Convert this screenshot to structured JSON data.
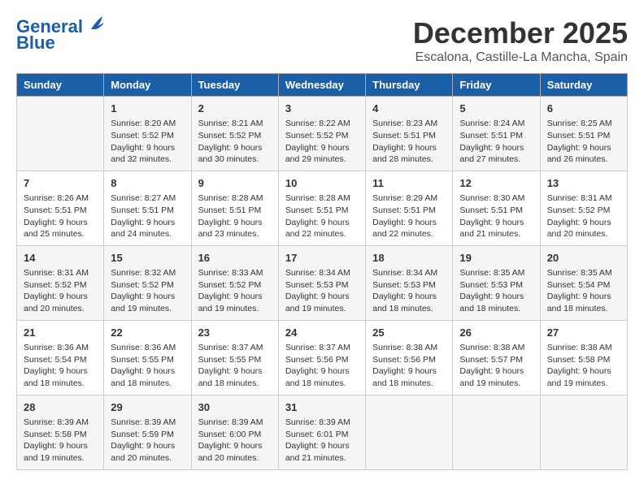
{
  "header": {
    "logo_line1": "General",
    "logo_line2": "Blue",
    "month_title": "December 2025",
    "subtitle": "Escalona, Castille-La Mancha, Spain"
  },
  "days_of_week": [
    "Sunday",
    "Monday",
    "Tuesday",
    "Wednesday",
    "Thursday",
    "Friday",
    "Saturday"
  ],
  "weeks": [
    [
      {
        "day": "",
        "info": ""
      },
      {
        "day": "1",
        "info": "Sunrise: 8:20 AM\nSunset: 5:52 PM\nDaylight: 9 hours\nand 32 minutes."
      },
      {
        "day": "2",
        "info": "Sunrise: 8:21 AM\nSunset: 5:52 PM\nDaylight: 9 hours\nand 30 minutes."
      },
      {
        "day": "3",
        "info": "Sunrise: 8:22 AM\nSunset: 5:52 PM\nDaylight: 9 hours\nand 29 minutes."
      },
      {
        "day": "4",
        "info": "Sunrise: 8:23 AM\nSunset: 5:51 PM\nDaylight: 9 hours\nand 28 minutes."
      },
      {
        "day": "5",
        "info": "Sunrise: 8:24 AM\nSunset: 5:51 PM\nDaylight: 9 hours\nand 27 minutes."
      },
      {
        "day": "6",
        "info": "Sunrise: 8:25 AM\nSunset: 5:51 PM\nDaylight: 9 hours\nand 26 minutes."
      }
    ],
    [
      {
        "day": "7",
        "info": "Sunrise: 8:26 AM\nSunset: 5:51 PM\nDaylight: 9 hours\nand 25 minutes."
      },
      {
        "day": "8",
        "info": "Sunrise: 8:27 AM\nSunset: 5:51 PM\nDaylight: 9 hours\nand 24 minutes."
      },
      {
        "day": "9",
        "info": "Sunrise: 8:28 AM\nSunset: 5:51 PM\nDaylight: 9 hours\nand 23 minutes."
      },
      {
        "day": "10",
        "info": "Sunrise: 8:28 AM\nSunset: 5:51 PM\nDaylight: 9 hours\nand 22 minutes."
      },
      {
        "day": "11",
        "info": "Sunrise: 8:29 AM\nSunset: 5:51 PM\nDaylight: 9 hours\nand 22 minutes."
      },
      {
        "day": "12",
        "info": "Sunrise: 8:30 AM\nSunset: 5:51 PM\nDaylight: 9 hours\nand 21 minutes."
      },
      {
        "day": "13",
        "info": "Sunrise: 8:31 AM\nSunset: 5:52 PM\nDaylight: 9 hours\nand 20 minutes."
      }
    ],
    [
      {
        "day": "14",
        "info": "Sunrise: 8:31 AM\nSunset: 5:52 PM\nDaylight: 9 hours\nand 20 minutes."
      },
      {
        "day": "15",
        "info": "Sunrise: 8:32 AM\nSunset: 5:52 PM\nDaylight: 9 hours\nand 19 minutes."
      },
      {
        "day": "16",
        "info": "Sunrise: 8:33 AM\nSunset: 5:52 PM\nDaylight: 9 hours\nand 19 minutes."
      },
      {
        "day": "17",
        "info": "Sunrise: 8:34 AM\nSunset: 5:53 PM\nDaylight: 9 hours\nand 19 minutes."
      },
      {
        "day": "18",
        "info": "Sunrise: 8:34 AM\nSunset: 5:53 PM\nDaylight: 9 hours\nand 18 minutes."
      },
      {
        "day": "19",
        "info": "Sunrise: 8:35 AM\nSunset: 5:53 PM\nDaylight: 9 hours\nand 18 minutes."
      },
      {
        "day": "20",
        "info": "Sunrise: 8:35 AM\nSunset: 5:54 PM\nDaylight: 9 hours\nand 18 minutes."
      }
    ],
    [
      {
        "day": "21",
        "info": "Sunrise: 8:36 AM\nSunset: 5:54 PM\nDaylight: 9 hours\nand 18 minutes."
      },
      {
        "day": "22",
        "info": "Sunrise: 8:36 AM\nSunset: 5:55 PM\nDaylight: 9 hours\nand 18 minutes."
      },
      {
        "day": "23",
        "info": "Sunrise: 8:37 AM\nSunset: 5:55 PM\nDaylight: 9 hours\nand 18 minutes."
      },
      {
        "day": "24",
        "info": "Sunrise: 8:37 AM\nSunset: 5:56 PM\nDaylight: 9 hours\nand 18 minutes."
      },
      {
        "day": "25",
        "info": "Sunrise: 8:38 AM\nSunset: 5:56 PM\nDaylight: 9 hours\nand 18 minutes."
      },
      {
        "day": "26",
        "info": "Sunrise: 8:38 AM\nSunset: 5:57 PM\nDaylight: 9 hours\nand 19 minutes."
      },
      {
        "day": "27",
        "info": "Sunrise: 8:38 AM\nSunset: 5:58 PM\nDaylight: 9 hours\nand 19 minutes."
      }
    ],
    [
      {
        "day": "28",
        "info": "Sunrise: 8:39 AM\nSunset: 5:58 PM\nDaylight: 9 hours\nand 19 minutes."
      },
      {
        "day": "29",
        "info": "Sunrise: 8:39 AM\nSunset: 5:59 PM\nDaylight: 9 hours\nand 20 minutes."
      },
      {
        "day": "30",
        "info": "Sunrise: 8:39 AM\nSunset: 6:00 PM\nDaylight: 9 hours\nand 20 minutes."
      },
      {
        "day": "31",
        "info": "Sunrise: 8:39 AM\nSunset: 6:01 PM\nDaylight: 9 hours\nand 21 minutes."
      },
      {
        "day": "",
        "info": ""
      },
      {
        "day": "",
        "info": ""
      },
      {
        "day": "",
        "info": ""
      }
    ]
  ]
}
